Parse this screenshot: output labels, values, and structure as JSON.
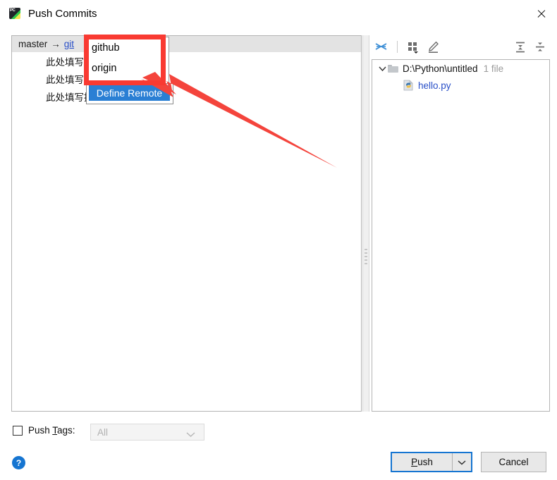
{
  "window": {
    "title": "Push Commits",
    "app_icon": "pycharm-icon",
    "close_icon": "close-icon"
  },
  "commits_panel": {
    "repo_header": {
      "branch": "master",
      "arrow": "→",
      "remote_link": "git"
    },
    "commit_rows": [
      {
        "message": "此处填写提交的说明"
      },
      {
        "message": "此处填写提交的说明"
      },
      {
        "message": "此处填写提交的说明"
      }
    ]
  },
  "remote_dropdown": {
    "items": [
      {
        "label": "github"
      },
      {
        "label": "origin"
      }
    ],
    "selected_action": "Define Remote"
  },
  "annotation": {
    "highlight_color": "#f93a32",
    "arrow_color": "#f4443c"
  },
  "files_panel": {
    "toolbar": [
      {
        "name": "collapse-to-arrows-icon",
        "title": "Expand Selection"
      },
      {
        "name": "group-by-icon",
        "title": "Group By"
      },
      {
        "name": "edit-pencil-icon",
        "title": "Edit Source"
      },
      {
        "name": "expand-all-icon",
        "title": "Expand All"
      },
      {
        "name": "collapse-all-icon",
        "title": "Collapse All"
      }
    ],
    "tree": {
      "directory": "D:\\Python\\untitled",
      "file_count": "1 file",
      "expanded": true,
      "files": [
        {
          "name": "hello.py",
          "icon": "python-file-icon"
        }
      ]
    }
  },
  "footer": {
    "push_tags": {
      "label_before": "Push ",
      "label_mnemonic": "T",
      "label_after": "ags:",
      "checked": false
    },
    "tags_combo": {
      "value": "All",
      "enabled": false
    },
    "help_label": "?",
    "push_button": "Push",
    "push_mnemonic": "P",
    "cancel_button": "Cancel"
  }
}
